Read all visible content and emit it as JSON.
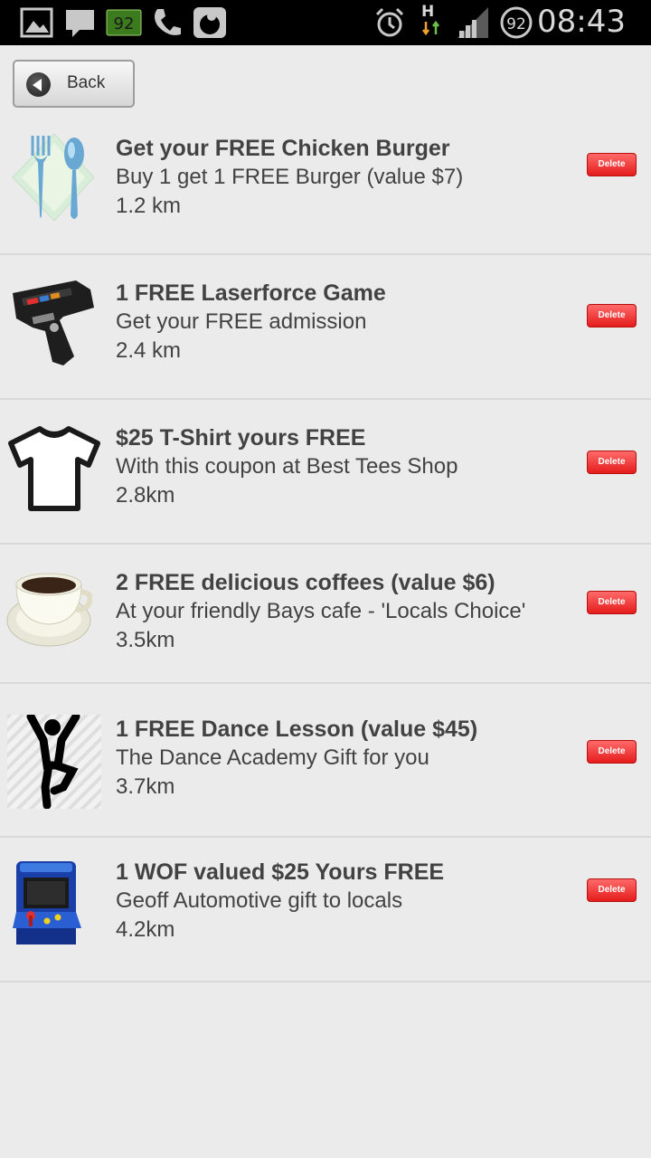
{
  "status_bar": {
    "battery_badge": "92",
    "network_type": "H",
    "battery_level": "92",
    "time": "08:43",
    "icons": [
      "gallery-icon",
      "message-icon",
      "battery-notification-icon",
      "phone-icon",
      "vodafone-icon",
      "alarm-icon",
      "network-h-icon",
      "signal-icon",
      "battery-circle-icon"
    ]
  },
  "header": {
    "back_label": "Back"
  },
  "coupons": [
    {
      "title": "Get your FREE Chicken Burger",
      "description": "Buy 1 get 1 FREE Burger (value $7)",
      "distance": "1.2 km",
      "icon": "cutlery-icon",
      "delete_label": "Delete"
    },
    {
      "title": "1 FREE Laserforce Game",
      "description": "Get your FREE admission",
      "distance": "2.4 km",
      "icon": "laser-gun-icon",
      "delete_label": "Delete"
    },
    {
      "title": "$25 T-Shirt yours FREE",
      "description": "With this coupon at Best Tees Shop",
      "distance": "2.8km",
      "icon": "tshirt-icon",
      "delete_label": "Delete"
    },
    {
      "title": "2 FREE delicious coffees (value $6)",
      "description": "At your friendly Bays cafe - 'Locals Choice'",
      "distance": "3.5km",
      "icon": "coffee-cup-icon",
      "delete_label": "Delete"
    },
    {
      "title": "1 FREE Dance Lesson (value $45)",
      "description": "The Dance Academy Gift for you",
      "distance": "3.7km",
      "icon": "dancer-icon",
      "delete_label": "Delete"
    },
    {
      "title": "1 WOF valued $25 Yours FREE",
      "description": "Geoff Automotive gift to locals",
      "distance": "4.2km",
      "icon": "arcade-machine-icon",
      "delete_label": "Delete"
    }
  ],
  "colors": {
    "background": "#ebebeb",
    "status_bar": "#000000",
    "delete_button": "#e51c1c",
    "text": "#424242"
  }
}
